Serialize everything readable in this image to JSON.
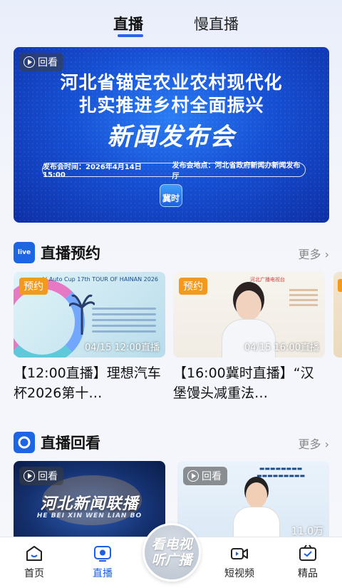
{
  "top_tabs": {
    "live": "直播",
    "slow_live": "慢直播"
  },
  "hero": {
    "badge": "回看",
    "line1": "河北省锚定农业农村现代化",
    "line2": "扎实推进乡村全面振兴",
    "line3": "新闻发布会",
    "info_time": "发布会时间：2026年4月14日15:00",
    "info_place": "发布会地点：河北省政府新闻办新闻发布厅",
    "logo_text": "冀时"
  },
  "appointments": {
    "title": "直播预约",
    "icon_text": "live",
    "more": "更多",
    "cards": [
      {
        "tag": "预约",
        "time": "04/15  12:00直播",
        "title": "【12:00直播】理想汽车杯2026第十…",
        "brand": "Li Auto Cup 17th TOUR OF HAINAN 2026"
      },
      {
        "tag": "预约",
        "time": "04/15  16:00直播",
        "title": "【16:00冀时直播】“汉堡馒头减重法…",
        "brand": "河北广播电视台"
      }
    ]
  },
  "replay": {
    "title": "直播回看",
    "more": "更多",
    "cards": [
      {
        "badge": "回看",
        "logo": "河北新闻联播",
        "sub": "HE BEI XIN WEN LIAN BO"
      },
      {
        "badge": "回看",
        "views": "11.0万"
      }
    ]
  },
  "bottom_nav": {
    "items": [
      "首页",
      "直播",
      "短视频",
      "精品"
    ],
    "center_line1": "看电视",
    "center_line2": "听广播",
    "active_color": "#1c5fe0"
  }
}
